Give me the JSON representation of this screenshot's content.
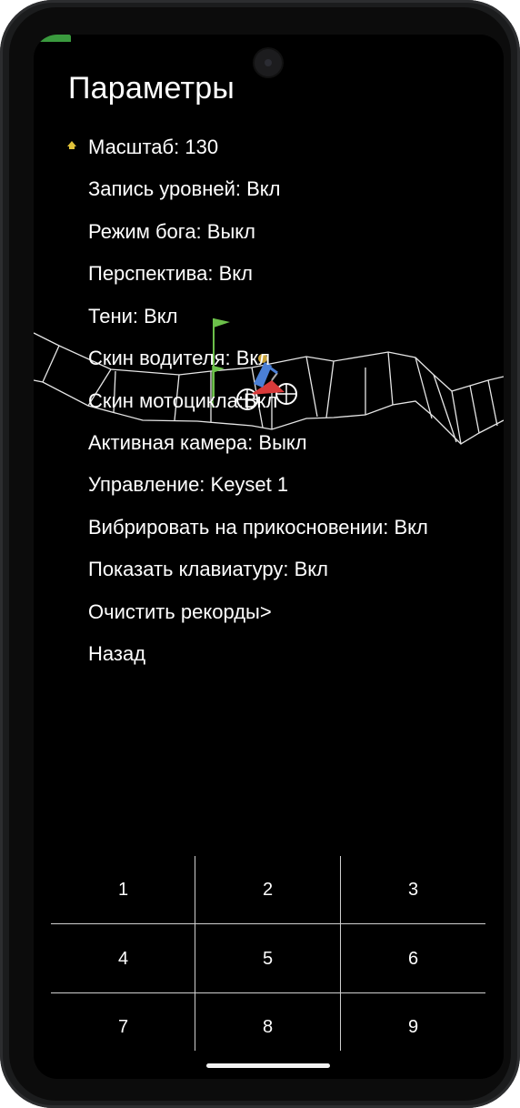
{
  "screen": {
    "title": "Параметры"
  },
  "menu": {
    "items": [
      {
        "label": "Масштаб: 130",
        "selected": true
      },
      {
        "label": "Запись уровней: Вкл"
      },
      {
        "label": "Режим бога: Выкл"
      },
      {
        "label": "Перспектива: Вкл"
      },
      {
        "label": "Тени: Вкл"
      },
      {
        "label": "Скин водителя: Вкл"
      },
      {
        "label": "Скин мотоцикла:Вкл"
      },
      {
        "label": "Активная камера: Выкл"
      },
      {
        "label": "Управление: Keyset 1"
      },
      {
        "label": "Вибрировать на прикосновении: Вкл"
      },
      {
        "label": "Показать клавиатуру: Вкл"
      },
      {
        "label": "Очистить рекорды>"
      },
      {
        "label": "Назад"
      }
    ],
    "selector_icon": "selector-arrow-icon"
  },
  "keypad": {
    "keys": [
      "1",
      "2",
      "3",
      "4",
      "5",
      "6",
      "7",
      "8",
      "9"
    ]
  },
  "colors": {
    "background": "#000000",
    "text": "#ffffff",
    "flag": "#6cc04a",
    "accent": "#3a9a3e",
    "grid": "#cfcfcf"
  },
  "icons": [
    "camera-cutout",
    "start-flag-icon",
    "motorcycle-rider-icon",
    "selector-arrow-icon"
  ]
}
